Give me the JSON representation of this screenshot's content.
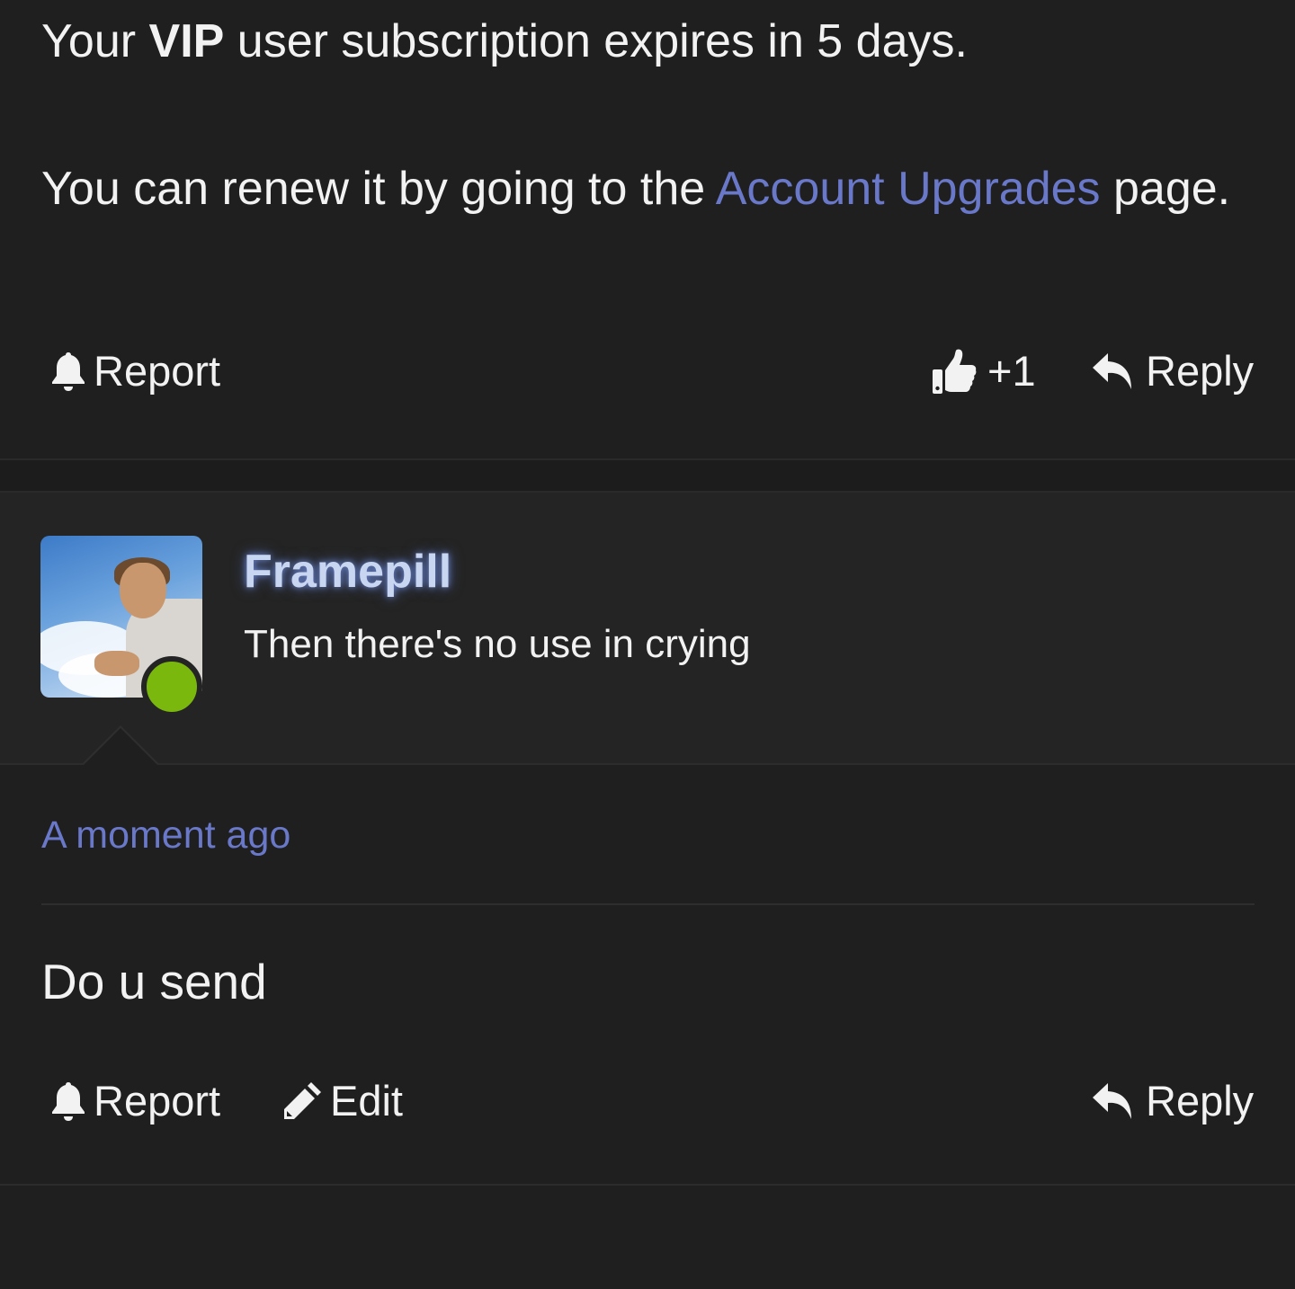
{
  "post1": {
    "line1_prefix": "Your ",
    "line1_bold": "VIP",
    "line1_suffix": " user subscription expires in 5 days.",
    "line2_prefix": "You can renew it by going to the ",
    "line2_link": "Account Upgrades",
    "line2_suffix": " page.",
    "actions": {
      "report_label": "Report",
      "like_count": "+1",
      "reply_label": "Reply"
    }
  },
  "user": {
    "name": "Framepill",
    "title": "Then there's no use in crying",
    "status": "online",
    "status_color": "#7ab80e",
    "name_glow_color": "#7896e6"
  },
  "post2": {
    "timestamp": "A moment ago",
    "message": "Do u send",
    "actions": {
      "report_label": "Report",
      "edit_label": "Edit",
      "reply_label": "Reply"
    }
  },
  "colors": {
    "background": "#1f1f1f",
    "header_background": "#242424",
    "link": "#6a78c9",
    "text": "#f2f2f2"
  },
  "icons": {
    "report": "bell-icon",
    "like": "thumbs-up-icon",
    "reply": "reply-arrow-icon",
    "edit": "pencil-icon"
  }
}
